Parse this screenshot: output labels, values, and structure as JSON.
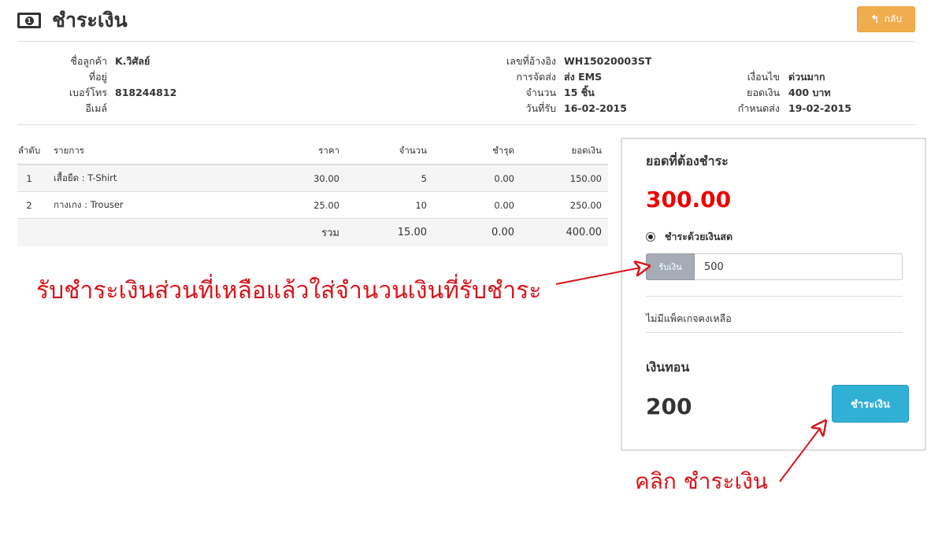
{
  "header": {
    "title": "ชำระเงิน",
    "back_label": "กลับ",
    "back_color": "#f0ad4e"
  },
  "customer": {
    "name_label": "ชื่อลูกค้า",
    "name": "K.วิศัลย์",
    "address_label": "ที่อยู่",
    "address": "",
    "phone_label": "เบอร์โทร",
    "phone": "818244812",
    "email_label": "อีเมล์",
    "email": ""
  },
  "order": {
    "ref_label": "เลขที่อ้างอิง",
    "ref": "WH15020003ST",
    "shipping_label": "การจัดส่ง",
    "shipping": "ส่ง EMS",
    "qty_label": "จำนวน",
    "qty": "15 ชิ้น",
    "received_label": "วันที่รับ",
    "received": "16-02-2015",
    "condition_label": "เงื่อนไข",
    "condition": "ด่วนมาก",
    "total_label": "ยอดเงิน",
    "total": "400 บาท",
    "due_label": "กำหนดส่ง",
    "due": "19-02-2015"
  },
  "table": {
    "headers": [
      "ลำดับ",
      "รายการ",
      "ราคา",
      "จำนวน",
      "ชำรุด",
      "ยอดเงิน"
    ],
    "rows": [
      [
        "1",
        "เสื้อยืด : T-Shirt",
        "30.00",
        "5",
        "0.00",
        "150.00"
      ],
      [
        "2",
        "กางเกง : Trouser",
        "25.00",
        "10",
        "0.00",
        "250.00"
      ]
    ],
    "summary": {
      "label": "รวม",
      "qty": "15.00",
      "damaged": "0.00",
      "total": "400.00"
    }
  },
  "payment": {
    "due_heading": "ยอดที่ต้องชำระ",
    "due_amount": "300.00",
    "due_color": "#ee0000",
    "method_label": "ชำระด้วยเงินสด",
    "received_addon": "รับเงิน",
    "received_value": "500",
    "package_note": "ไม่มีแพ็คเกจคงเหลือ",
    "change_heading": "เงินทอน",
    "change_amount": "200",
    "pay_button": "ชำระเงิน",
    "pay_color": "#31b0d5"
  },
  "annotations": {
    "receive_note": "รับชำระเงินส่วนที่เหลือแล้วใส่จำนวนเงินที่รับชำระ",
    "click_note": "คลิก ชำระเงิน",
    "color": "#d9141b"
  }
}
